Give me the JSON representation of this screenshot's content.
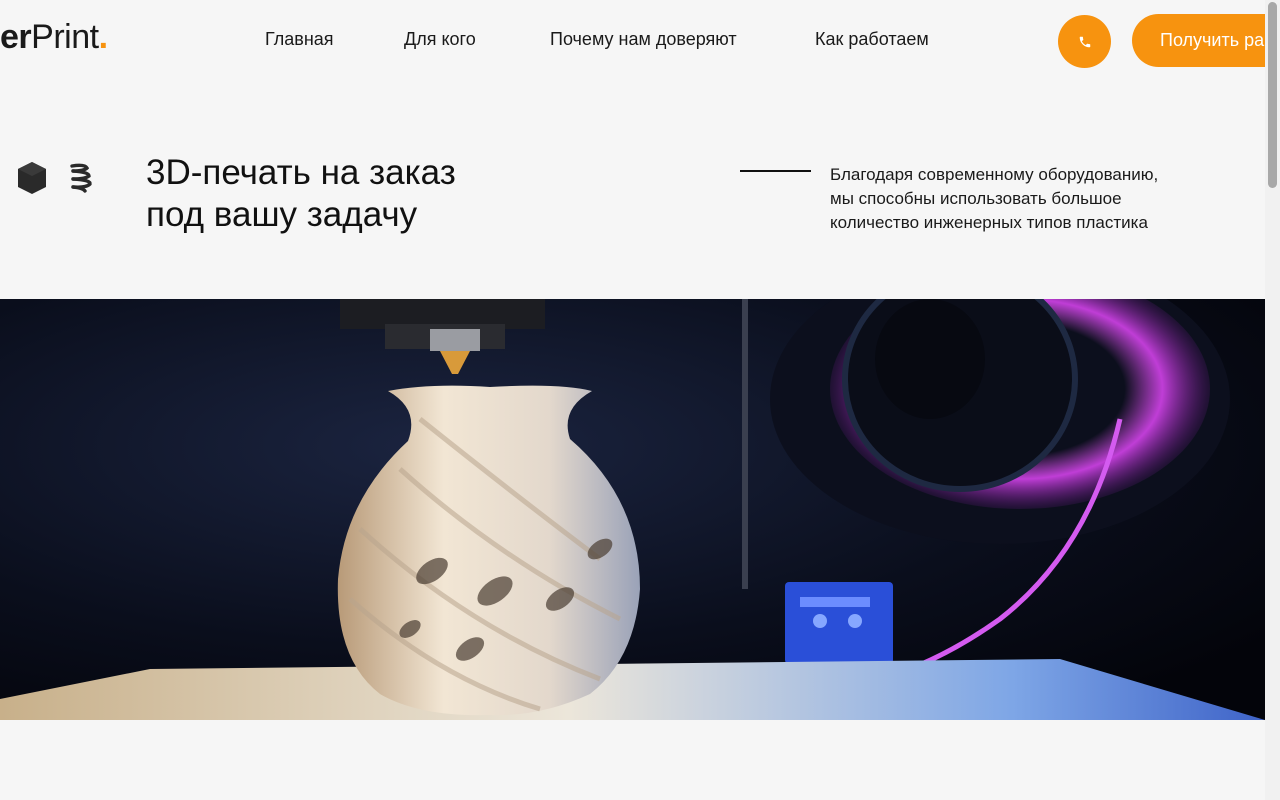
{
  "header": {
    "logo": {
      "prefix": "er",
      "main": "Print",
      "dot": "."
    },
    "nav": [
      {
        "label": "Главная"
      },
      {
        "label": "Для кого"
      },
      {
        "label": "Почему нам доверяют"
      },
      {
        "label": "Как работаем"
      }
    ],
    "phone_icon": "phone-icon",
    "cta_label": "Получить ра"
  },
  "hero": {
    "title_line1": "3D-печать на заказ",
    "title_line2": "под вашу задачу",
    "description_lines": [
      "Благодаря современному оборудованию,",
      "мы способны использовать большое",
      "количество инженерных типов пластика"
    ],
    "icons": [
      "cube-icon",
      "spiral-icon"
    ],
    "image_icon": "3d-printed-vase-photo"
  },
  "colors": {
    "accent": "#f7930f",
    "background": "#f6f6f6",
    "text": "#111111"
  }
}
